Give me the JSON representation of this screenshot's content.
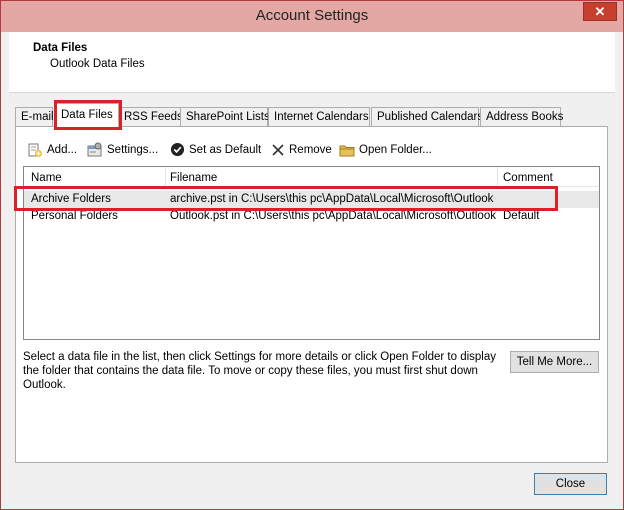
{
  "window": {
    "title": "Account Settings",
    "close_glyph": "✕"
  },
  "header": {
    "title": "Data Files",
    "subtitle": "Outlook Data Files"
  },
  "tabs": [
    {
      "label": "E-mail"
    },
    {
      "label": "Data Files",
      "active": true
    },
    {
      "label": "RSS Feeds"
    },
    {
      "label": "SharePoint Lists"
    },
    {
      "label": "Internet Calendars"
    },
    {
      "label": "Published Calendars"
    },
    {
      "label": "Address Books"
    }
  ],
  "toolbar": {
    "add_label": "Add...",
    "settings_label": "Settings...",
    "set_default_label": "Set as Default",
    "remove_label": "Remove",
    "open_folder_label": "Open Folder..."
  },
  "table": {
    "columns": [
      "Name",
      "Filename",
      "Comment"
    ],
    "rows": [
      {
        "name": "Archive Folders",
        "filename": "archive.pst in C:\\Users\\this pc\\AppData\\Local\\Microsoft\\Outlook",
        "comment": "",
        "selected": true
      },
      {
        "name": "Personal Folders",
        "filename": "Outlook.pst in C:\\Users\\this pc\\AppData\\Local\\Microsoft\\Outlook",
        "comment": "Default",
        "selected": false
      }
    ]
  },
  "info_text": "Select a data file in the list, then click Settings for more details or click Open Folder to display the folder that contains the data file. To move or copy these files, you must first shut down Outlook.",
  "buttons": {
    "tell_me_more": "Tell Me More...",
    "close": "Close"
  },
  "colors": {
    "highlight": "#d6232a",
    "titlebar": "#e3a8a4",
    "close_button": "#c7402f"
  }
}
